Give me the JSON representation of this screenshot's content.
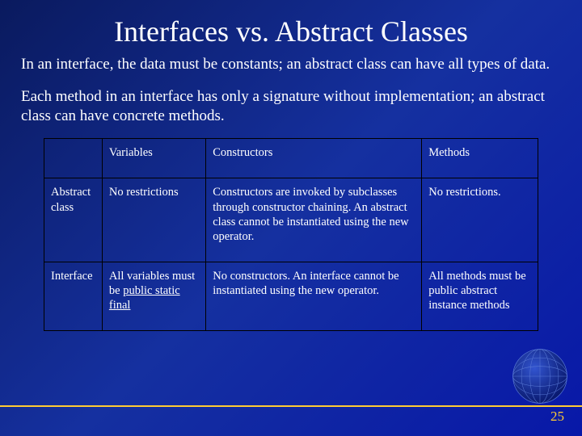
{
  "title": "Interfaces vs. Abstract Classes",
  "paragraphs": [
    "In an interface, the data must be constants; an abstract class can have all types of data.",
    "Each method in an interface has only a signature without implementation; an abstract class can have concrete methods."
  ],
  "table": {
    "headers": {
      "c1": "",
      "c2": "Variables",
      "c3": "Constructors",
      "c4": "Methods"
    },
    "rows": [
      {
        "c1": "Abstract class",
        "c2": "No restrictions",
        "c3": "Constructors are invoked by subclasses through constructor chaining. An abstract class cannot be instantiated using the new operator.",
        "c4": "No restrictions."
      },
      {
        "c1": "Interface",
        "c2_prefix": "All variables must be ",
        "c2_underlined": "public static final",
        "c3": "No constructors. An interface cannot be instantiated using the new operator.",
        "c4": "All methods must be public abstract instance methods"
      }
    ]
  },
  "slide_number": "25"
}
